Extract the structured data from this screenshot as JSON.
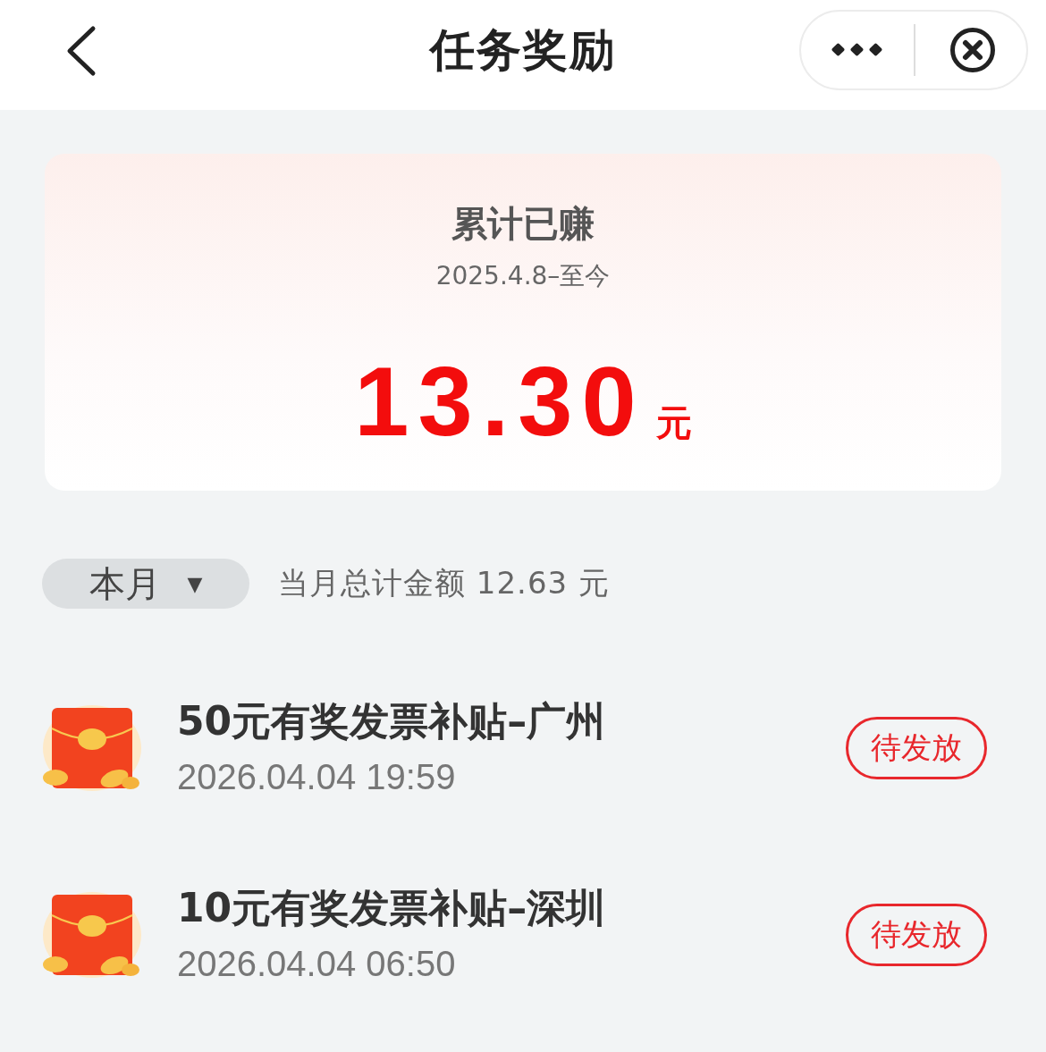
{
  "header": {
    "title": "任务奖励"
  },
  "summary": {
    "label": "累计已赚",
    "period": "2025.4.8–至今",
    "amount": "13.30",
    "unit": "元"
  },
  "filter": {
    "selected": "本月",
    "arrow": "▼",
    "total": "当月总计金额 12.63 元"
  },
  "rewards": [
    {
      "title": "50元有奖发票补贴–广州",
      "time": "2026.04.04 19:59",
      "status": "待发放"
    },
    {
      "title": "10元有奖发票补贴–深圳",
      "time": "2026.04.04 06:50",
      "status": "待发放"
    }
  ]
}
